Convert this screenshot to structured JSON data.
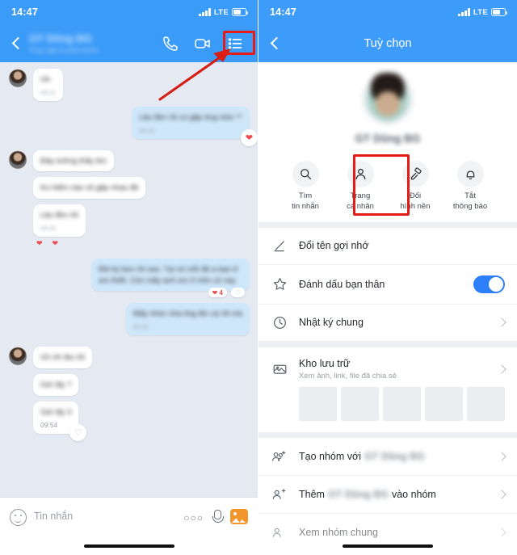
{
  "status_bar": {
    "time": "14:47",
    "network": "LTE"
  },
  "left_panel": {
    "header": {
      "contact_name": "GT Dũng BG",
      "contact_status": "Truy cập 5 phút trước",
      "back_icon": "back-chevron-icon",
      "call_icon": "phone-icon",
      "video_icon": "video-camera-icon",
      "menu_icon": "list-menu-icon"
    },
    "messages": [
      {
        "side": "in",
        "text": "Uh",
        "time": "09:12",
        "reaction": ""
      },
      {
        "side": "out",
        "text": "Lâu lắm rồi có gặp ông nữa ^^",
        "time": "09:15",
        "reaction": "heart"
      },
      {
        "side": "in",
        "text": "Đây tưởng thấy êm",
        "time": "",
        "reaction": ""
      },
      {
        "side": "in",
        "text": "Ko hiểm nào vô gặp nhau đb",
        "time": "",
        "reaction": ""
      },
      {
        "side": "in",
        "text": "Lâu lắm rồi",
        "time": "09:20",
        "reaction": "hearts"
      },
      {
        "side": "out",
        "text": "Đkl kỳ bọn rồi sao. Tại cô mỗi đb a bạn ở em thiết. Còn mấy anh em ở trên cũ nay",
        "time": "",
        "reaction": "pill"
      },
      {
        "side": "out",
        "text": "Mấy nhóc nhà ông lên cả rồi mà",
        "time": "09:34",
        "reaction": ""
      },
      {
        "side": "in",
        "text": "Uh ừh lâu rồi",
        "time": "",
        "reaction": ""
      },
      {
        "side": "in",
        "text": "Giờ lấy ?",
        "time": "",
        "reaction": ""
      },
      {
        "side": "in",
        "text": "Giờ lấy 3",
        "time": "09:54",
        "reaction": "heart-empty"
      }
    ],
    "input_bar": {
      "emoji_icon": "smiley-icon",
      "placeholder": "Tin nhắn",
      "more_icon": "more-options-icon",
      "mic_icon": "microphone-icon",
      "gallery_icon": "image-gallery-icon"
    },
    "annotation": {
      "highlight": "list-menu-icon",
      "arrow": "red-arrow-pointer"
    }
  },
  "right_panel": {
    "header": {
      "title": "Tuỳ chọn",
      "back_icon": "back-chevron-icon"
    },
    "profile": {
      "name": "GT Dũng BG",
      "avatar": "profile-avatar"
    },
    "actions": [
      {
        "icon": "search-icon",
        "line1": "Tìm",
        "line2": "tin nhắn",
        "highlighted": false
      },
      {
        "icon": "person-icon",
        "line1": "Trang",
        "line2": "cá nhân",
        "highlighted": true
      },
      {
        "icon": "paint-roller-icon",
        "line1": "Đổi",
        "line2": "hình nền",
        "highlighted": false
      },
      {
        "icon": "bell-icon",
        "line1": "Tắt",
        "line2": "thông báo",
        "highlighted": false
      }
    ],
    "menu_group_1": [
      {
        "icon": "pencil-icon",
        "title": "Đổi tên gợi nhớ",
        "sub": "",
        "control": "none"
      },
      {
        "icon": "star-icon",
        "title": "Đánh dấu bạn thân",
        "sub": "",
        "control": "toggle",
        "toggle_on": true
      },
      {
        "icon": "clock-icon",
        "title": "Nhật ký chung",
        "sub": "",
        "control": "chevron"
      }
    ],
    "storage": {
      "icon": "photo-archive-icon",
      "title": "Kho lưu trữ",
      "sub": "Xem ảnh, link, file đã chia sẻ",
      "control": "chevron",
      "thumbnails": 5
    },
    "menu_group_2": [
      {
        "icon": "group-add-icon",
        "prefix": "Tạo nhóm với ",
        "blurred_name": "GT Dũng BG",
        "suffix": "",
        "control": "chevron"
      },
      {
        "icon": "person-add-icon",
        "prefix": "Thêm ",
        "blurred_name": "GT Dũng BG",
        "suffix": " vào nhóm",
        "control": "chevron"
      },
      {
        "icon": "person-block-icon",
        "prefix": "Xem nhóm chung",
        "blurred_name": "",
        "suffix": "",
        "control": "chevron"
      }
    ],
    "colors": {
      "accent": "#3B9BF8",
      "toggle_on": "#2D7FF9",
      "highlight": "#e41b17"
    }
  }
}
